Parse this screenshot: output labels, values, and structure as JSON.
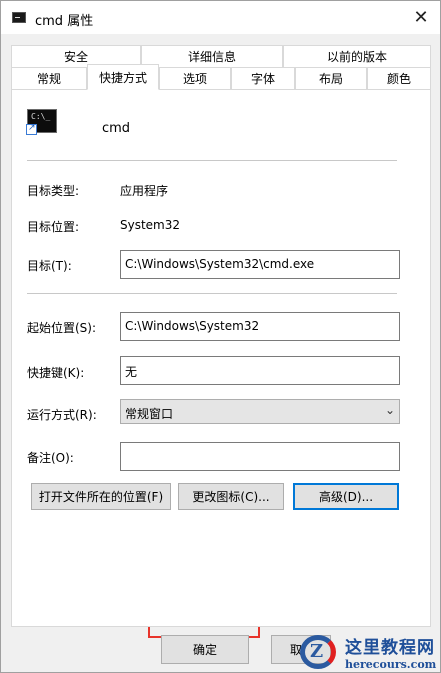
{
  "window": {
    "title": "cmd 属性",
    "close_glyph": "✕"
  },
  "tabs": {
    "row1": [
      "安全",
      "详细信息",
      "以前的版本"
    ],
    "row2": [
      "常规",
      "快捷方式",
      "选项",
      "字体",
      "布局",
      "颜色"
    ],
    "active": "快捷方式"
  },
  "shortcut": {
    "app_icon_text": "C:\\_",
    "app_name": "cmd",
    "target_type_label": "目标类型:",
    "target_type_value": "应用程序",
    "target_location_label": "目标位置:",
    "target_location_value": "System32",
    "target_label": "目标(T):",
    "target_value": "C:\\Windows\\System32\\cmd.exe",
    "start_in_label": "起始位置(S):",
    "start_in_value": "C:\\Windows\\System32",
    "hotkey_label": "快捷键(K):",
    "hotkey_value": "无",
    "run_label": "运行方式(R):",
    "run_value": "常规窗口",
    "comment_label": "备注(O):",
    "comment_value": "",
    "open_location_button": "打开文件所在的位置(F)",
    "change_icon_button": "更改图标(C)...",
    "advanced_button": "高级(D)..."
  },
  "footer": {
    "ok_button": "确定",
    "cancel_button_partial": "取"
  },
  "watermark": {
    "logo_letter": "Z",
    "title": "这里教程网",
    "subtitle": "herecours.com"
  },
  "colors": {
    "accent": "#0078d7",
    "highlight": "#e8332a"
  }
}
